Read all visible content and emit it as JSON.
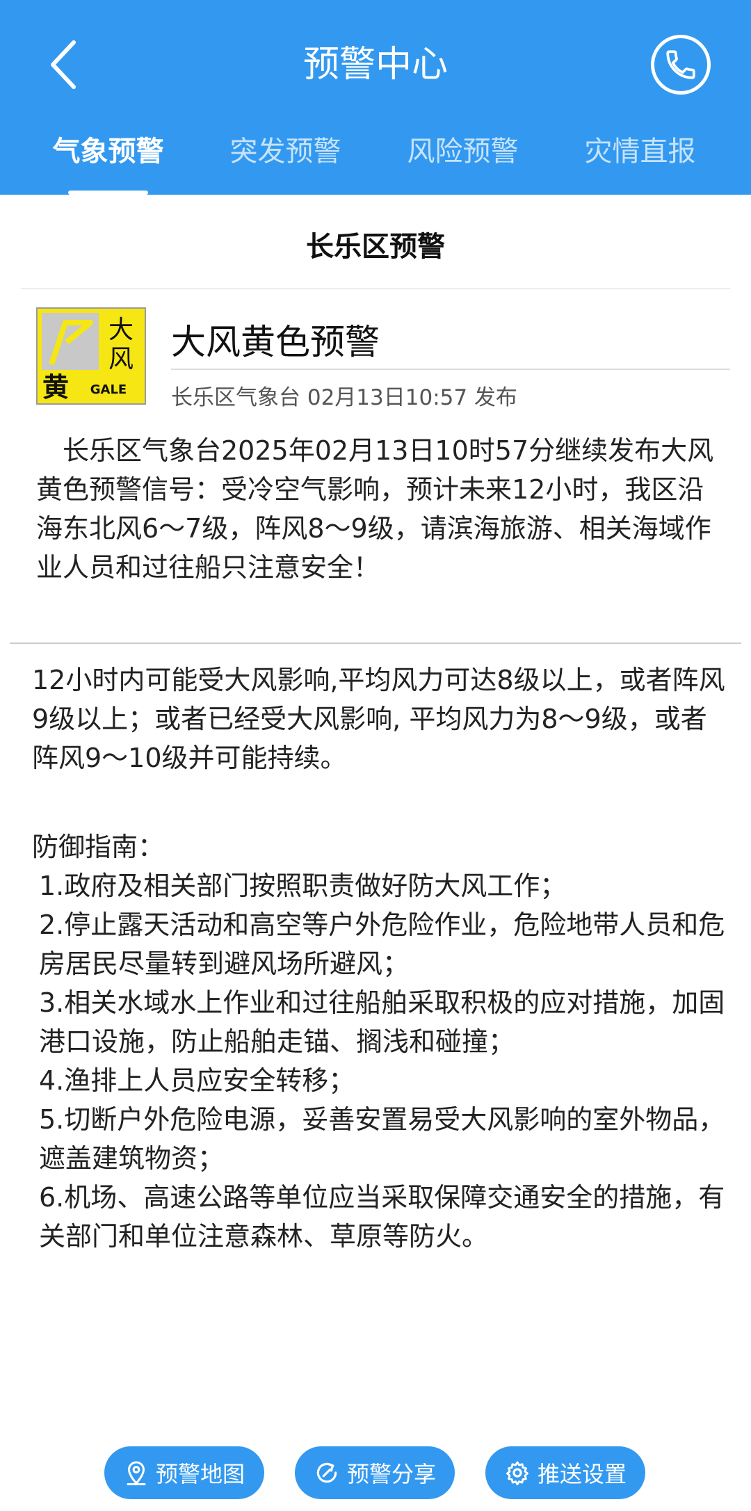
{
  "header": {
    "title": "预警中心",
    "back_icon": "chevron-left-icon",
    "phone_icon": "phone-icon"
  },
  "tabs": [
    {
      "label": "气象预警",
      "active": true
    },
    {
      "label": "突发预警",
      "active": false
    },
    {
      "label": "风险预警",
      "active": false
    },
    {
      "label": "灾情直报",
      "active": false
    }
  ],
  "region_title": "长乐区预警",
  "warning": {
    "icon": {
      "char_top": "大",
      "char_mid": "风",
      "char_level": "黄",
      "code": "GALE"
    },
    "title": "大风黄色预警",
    "source": "长乐区气象台 02月13日10:57 发布",
    "content": "长乐区气象台2025年02月13日10时57分继续发布大风黄色预警信号：受冷空气影响，预计未来12小时，我区沿海东北风6～7级，阵风8～9级，请滨海旅游、相关海域作业人员和过往船只注意安全！"
  },
  "standard": "12小时内可能受大风影响,平均风力可达8级以上，或者阵风9级以上；或者已经受大风影响, 平均风力为8～9级，或者阵风9～10级并可能持续。",
  "guide": {
    "heading": "防御指南：",
    "items": [
      "1.政府及相关部门按照职责做好防大风工作；",
      "2.停止露天活动和高空等户外危险作业，危险地带人员和危房居民尽量转到避风场所避风；",
      "3.相关水域水上作业和过往船舶采取积极的应对措施，加固港口设施，防止船舶走锚、搁浅和碰撞；",
      "4.渔排上人员应安全转移；",
      "5.切断户外危险电源，妥善安置易受大风影响的室外物品，遮盖建筑物资；",
      "6.机场、高速公路等单位应当采取保障交通安全的措施，有关部门和单位注意森林、草原等防火。"
    ]
  },
  "bottom_buttons": [
    {
      "label": "预警地图",
      "icon": "map-pin-icon"
    },
    {
      "label": "预警分享",
      "icon": "share-icon"
    },
    {
      "label": "推送设置",
      "icon": "gear-icon"
    }
  ],
  "colors": {
    "primary": "#3399f0",
    "warning_yellow": "#f5e614"
  }
}
